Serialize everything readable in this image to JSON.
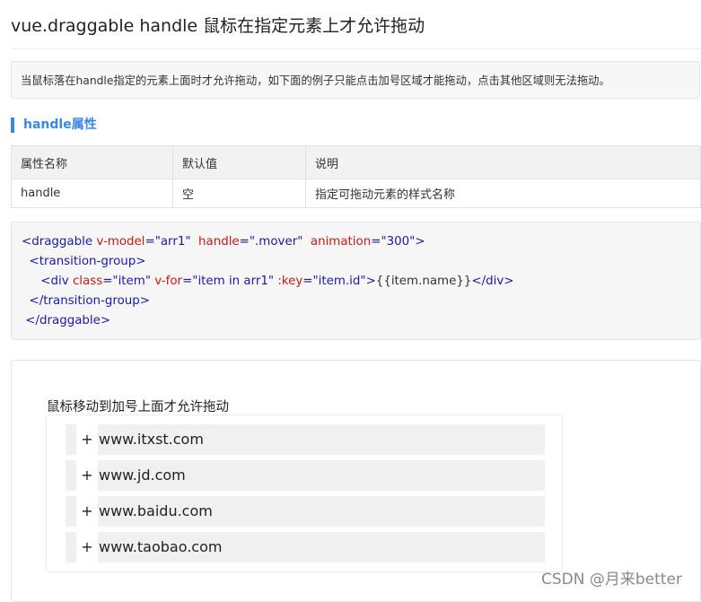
{
  "page": {
    "title": "vue.draggable handle 鼠标在指定元素上才允许拖动",
    "note": "当鼠标落在handle指定的元素上面时才允许拖动，如下面的例子只能点击加号区域才能拖动，点击其他区域则无法拖动。"
  },
  "section": {
    "heading": "handle属性"
  },
  "table": {
    "headers": [
      "属性名称",
      "默认值",
      "说明"
    ],
    "rows": [
      [
        "handle",
        "空",
        "指定可拖动元素的样式名称"
      ]
    ]
  },
  "code": {
    "l1_open": "<draggable",
    "l1_a1": "v-model",
    "l1_v1": "=\"arr1\"",
    "l1_a2": "handle",
    "l1_v2": "=\".mover\"",
    "l1_a3": "animation",
    "l1_v3": "=\"300\">",
    "l2": "<transition-group>",
    "l3_open": "<div",
    "l3_a1": "class",
    "l3_v1": "=\"item\"",
    "l3_a2": "v-for",
    "l3_v2": "=\"item in arr1\"",
    "l3_a3": ":key",
    "l3_v3": "=\"item.id\">",
    "l3_text": "{{item.name}}",
    "l3_close": "</div>",
    "l4": "</transition-group>",
    "l5": "</draggable>"
  },
  "demo": {
    "caption": "鼠标移动到加号上面才允许拖动",
    "handle_glyph": "+",
    "items": [
      "www.itxst.com",
      "www.jd.com",
      "www.baidu.com",
      "www.taobao.com"
    ]
  },
  "watermark": "CSDN @月来better",
  "colors": {
    "accent": "#3a87e6",
    "code_tag": "#1a1aa6",
    "code_attr": "#c41a16",
    "item_bg": "#f0f0f0"
  }
}
